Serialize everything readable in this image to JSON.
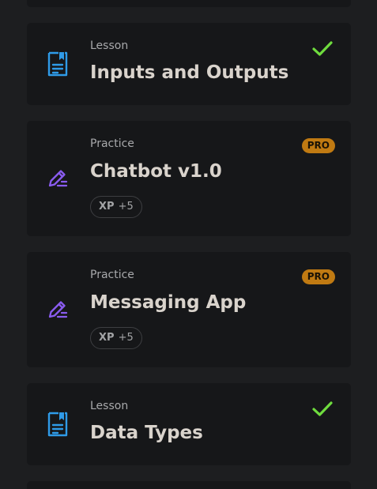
{
  "colors": {
    "background": "#1d1e20",
    "card": "#161719",
    "lesson_icon": "#2f9be8",
    "practice_icon": "#8a5cf0",
    "check": "#6fdc3e",
    "pro_badge": "#c07a12"
  },
  "cards": [
    {
      "kind": "Lesson",
      "title": "Inputs and Outputs",
      "icon": "document-icon",
      "status": "completed-check-icon"
    },
    {
      "kind": "Practice",
      "title": "Chatbot v1.0",
      "icon": "pencil-icon",
      "badge": "PRO",
      "xp_label": "XP",
      "xp_value": "+5"
    },
    {
      "kind": "Practice",
      "title": "Messaging App",
      "icon": "pencil-icon",
      "badge": "PRO",
      "xp_label": "XP",
      "xp_value": "+5"
    },
    {
      "kind": "Lesson",
      "title": "Data Types",
      "icon": "document-icon",
      "status": "completed-check-icon"
    }
  ]
}
